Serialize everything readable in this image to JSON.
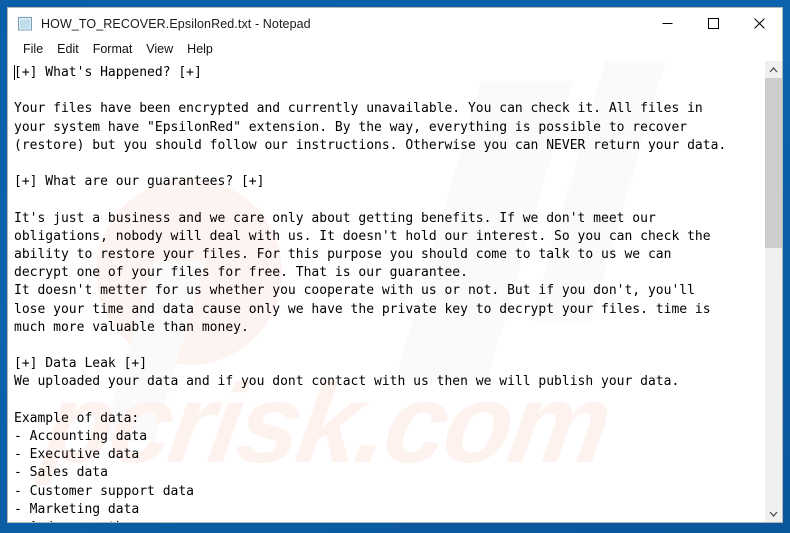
{
  "window": {
    "title": "HOW_TO_RECOVER.EpsilonRed.txt - Notepad",
    "icon": "notepad-icon",
    "minimize_label": "Minimize",
    "maximize_label": "Maximize",
    "close_label": "Close"
  },
  "menu": {
    "items": [
      {
        "label": "File"
      },
      {
        "label": "Edit"
      },
      {
        "label": "Format"
      },
      {
        "label": "View"
      },
      {
        "label": "Help"
      }
    ]
  },
  "scrollbar": {
    "up_arrow": "scroll-up-icon",
    "down_arrow": "scroll-down-icon"
  },
  "watermark": {
    "text": "pcrisk.com"
  },
  "document": {
    "body": "[+] What's Happened? [+]\n\nYour files have been encrypted and currently unavailable. You can check it. All files in\nyour system have \"EpsilonRed\" extension. By the way, everything is possible to recover\n(restore) but you should follow our instructions. Otherwise you can NEVER return your data.\n\n[+] What are our guarantees? [+]\n\nIt's just a business and we care only about getting benefits. If we don't meet our\nobligations, nobody will deal with us. It doesn't hold our interest. So you can check the\nability to restore your files. For this purpose you should come to talk to us we can\ndecrypt one of your files for free. That is our guarantee.\nIt doesn't metter for us whether you cooperate with us or not. But if you don't, you'll\nlose your time and data cause only we have the private key to decrypt your files. time is\nmuch more valuable than money.\n\n[+] Data Leak [+]\nWe uploaded your data and if you dont contact with us then we will publish your data.\n\nExample of data:\n- Accounting data\n- Executive data\n- Sales data\n- Customer support data\n- Marketing data\n- And more other ..."
  }
}
